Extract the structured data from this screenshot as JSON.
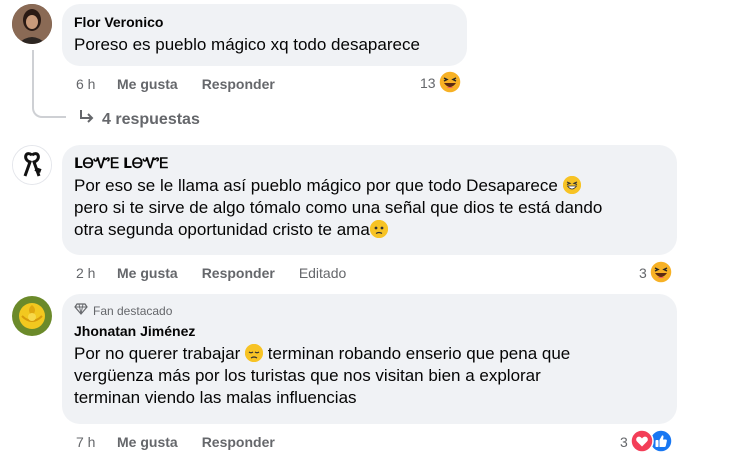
{
  "comments": [
    {
      "author": "Flor Veronico",
      "text": "Poreso es pueblo mágico xq todo desaparece",
      "time": "6 h",
      "like_label": "Me gusta",
      "reply_label": "Responder",
      "reaction_count": "13",
      "replies_label": "4 respuestas"
    },
    {
      "author": "ᒪᎾᏉᎬ ᒪᎾᏉᎬ",
      "text_line1": "Por eso se le llama así pueblo mágico por que todo Desaparece",
      "text_line2": "pero si te sirve de algo tómalo como una señal que dios te está dando",
      "text_line3": "otra segunda oportunidad cristo te ama",
      "time": "2 h",
      "like_label": "Me gusta",
      "reply_label": "Responder",
      "edited_label": "Editado",
      "reaction_count": "3"
    },
    {
      "badge": "Fan destacado",
      "author": "Jhonatan Jiménez",
      "text_line1": "Por no querer trabajar",
      "text_line1b": "terminan robando enserio que pena que",
      "text_line2": "vergüenza más por los turistas que nos visitan bien a explorar",
      "text_line3": "terminan viendo las malas influencias",
      "time": "7 h",
      "like_label": "Me gusta",
      "reply_label": "Responder",
      "reaction_count": "3"
    }
  ],
  "icons": {
    "reaction1": "laughing-emoji-icon",
    "reaction2": "laughing-emoji-icon",
    "reaction3a": "love-heart-icon",
    "reaction3b": "like-thumb-icon",
    "reply_arrow": "reply-arrow-icon",
    "fan_badge": "diamond-icon"
  },
  "colors": {
    "bubble": "#f0f2f5",
    "secondary_text": "#65676b",
    "like_blue": "#1877f2",
    "love_red": "#f33e58"
  }
}
